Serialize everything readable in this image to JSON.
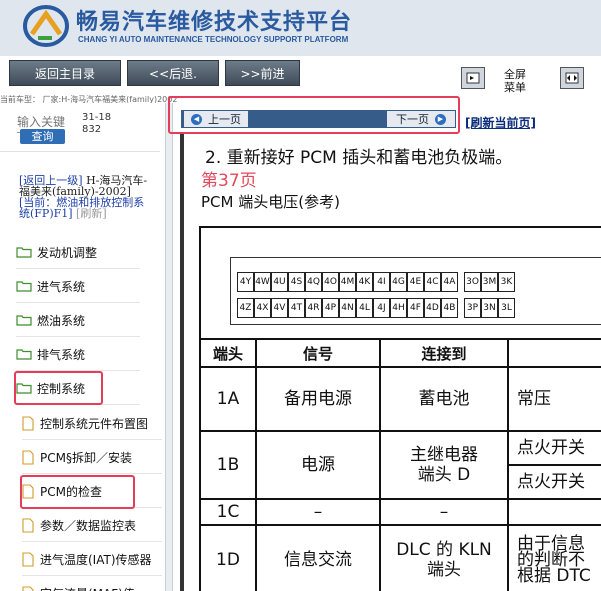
{
  "header": {
    "title_cn": "畅易汽车维修技术支持平台",
    "title_en": "CHANG YI AUTO MAINTENANCE TECHNOLOGY SUPPORT PLATFORM"
  },
  "toolbar": {
    "home_label": "返回主目录",
    "back_label": "<<后退.",
    "forward_label": ">>前进",
    "fullscreen_label_1": "全屏",
    "menu_label_1": "菜单"
  },
  "vehicle_line": "当前车型：  厂家:H-海马汽车福美来(family)2002",
  "sidebar": {
    "search_placeholder": "输入关键",
    "search_value": "31-18832",
    "search_button": "查询",
    "back_up_link": "[返回上一级]",
    "vehicle_text": "H-海马汽车-福美来(family)-2002]",
    "current_label": "[当前：燃油和排放控制系统(FP)F1]",
    "refresh_link": "[刷新]",
    "folders": [
      {
        "label": "发动机调整"
      },
      {
        "label": "进气系统"
      },
      {
        "label": "燃油系统"
      },
      {
        "label": "排气系统"
      },
      {
        "label": "控制系统"
      }
    ],
    "docs": [
      {
        "label": "控制系统元件布置图"
      },
      {
        "label": "PCM§拆卸／安装"
      },
      {
        "label": "PCM的检查"
      },
      {
        "label": "参数／数据监控表"
      },
      {
        "label": "进气温度(IAT)传感器"
      },
      {
        "label": "空气流量(MAF)传"
      }
    ]
  },
  "nav": {
    "prev_label": "上一页",
    "next_label": "下一页",
    "refresh_label": "[刷新当前页]"
  },
  "document": {
    "step_text": "2. 重新接好 PCM 插头和蓄电池负极端。",
    "page_number": "第37页",
    "subtitle": "PCM 端头电压(参考)",
    "pins_top": [
      "4Y",
      "4W",
      "4U",
      "4S",
      "4Q",
      "4O",
      "4M",
      "4K",
      "4I",
      "4G",
      "4E",
      "4C",
      "4A",
      "3O",
      "3M",
      "3K"
    ],
    "pins_bottom": [
      "4Z",
      "4X",
      "4V",
      "4T",
      "4R",
      "4P",
      "4N",
      "4L",
      "4J",
      "4H",
      "4F",
      "4D",
      "4B",
      "3P",
      "3N",
      "3L"
    ],
    "table": {
      "headers": [
        "端头",
        "信号",
        "连接到",
        ""
      ],
      "rows": [
        {
          "terminal": "1A",
          "signal": "备用电源",
          "connect": "蓄电池",
          "cond": "常压"
        },
        {
          "terminal": "1B",
          "signal": "电源",
          "connect": "主继电器\n端头 D",
          "cond": "点火开关",
          "cond2": "点火开关"
        },
        {
          "terminal": "1C",
          "signal": "–",
          "connect": "–",
          "cond": ""
        },
        {
          "terminal": "1D",
          "signal": "信息交流",
          "connect": "DLC 的 KLN\n端头",
          "cond": "由于信息\n的判断不\n根据 DTC"
        }
      ]
    }
  }
}
